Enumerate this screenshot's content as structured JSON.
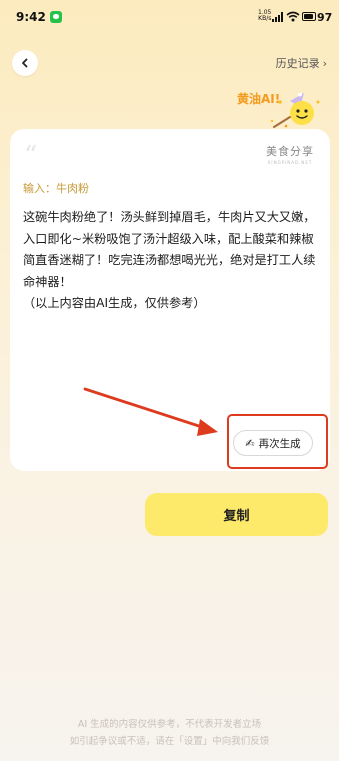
{
  "status_bar": {
    "time": "9:42",
    "net_speed_value": "1.05",
    "net_speed_unit": "KB/s",
    "battery": "97"
  },
  "header": {
    "history_label": "历史记录"
  },
  "assistant": {
    "name": "黄油AI!"
  },
  "card": {
    "brand_cn": "美食分享",
    "brand_en": "XINGPINAD.NET",
    "input_label": "输入：牛肉粉",
    "result_text": "这碗牛肉粉绝了！汤头鲜到掉眉毛，牛肉片又大又嫩，入口即化~米粉吸饱了汤汁超级入味，配上酸菜和辣椒简直香迷糊了！吃完连汤都想喝光光，绝对是打工人续命神器！\n（以上内容由AI生成，仅供参考）",
    "regenerate_label": "再次生成"
  },
  "actions": {
    "copy_label": "复制"
  },
  "footer": {
    "disclaimer_line1": "AI 生成的内容仅供参考，不代表开发者立场",
    "disclaimer_line2": "如引起争议或不适，请在「设置」中向我们反馈"
  },
  "colors": {
    "accent_yellow": "#fde96a",
    "label_gold": "#c79a36",
    "annotation_red": "#de3b1e"
  }
}
